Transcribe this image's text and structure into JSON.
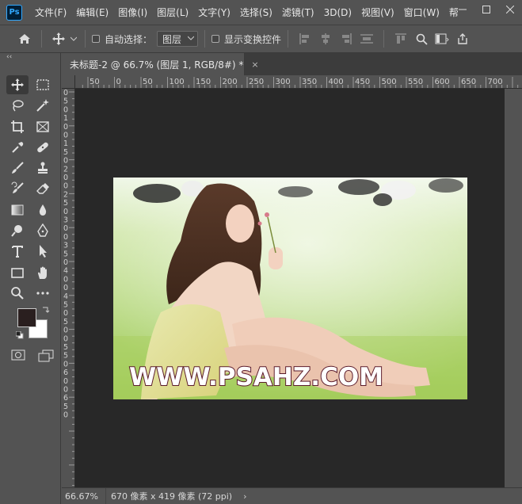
{
  "app": {
    "logo_text": "Ps",
    "menu": [
      "文件(F)",
      "编辑(E)",
      "图像(I)",
      "图层(L)",
      "文字(Y)",
      "选择(S)",
      "滤镜(T)",
      "3D(D)",
      "视图(V)",
      "窗口(W)",
      "帮"
    ],
    "window_controls": [
      "minimize-icon",
      "maximize-icon",
      "close-icon"
    ]
  },
  "options": {
    "home_icon": "home-icon",
    "move_icon": "move-tool-icon",
    "auto_select_label": "自动选择：",
    "auto_select_checked": false,
    "target_select": "图层",
    "show_transform_label": "显示变换控件",
    "show_transform_checked": false,
    "right_icons": [
      "align-top-edges-icon",
      "search-icon",
      "workspace-icon",
      "share-icon"
    ]
  },
  "tools": {
    "collapse_label": "‹‹",
    "items": [
      "move-tool-icon",
      "rect-marquee-icon",
      "lasso-icon",
      "magic-wand-icon",
      "crop-icon",
      "frame-icon",
      "eyedropper-icon",
      "healing-brush-icon",
      "brush-icon",
      "stamp-icon",
      "history-brush-icon",
      "eraser-icon",
      "gradient-icon",
      "blur-icon",
      "dodge-icon",
      "pen-icon",
      "type-icon",
      "path-select-icon",
      "rectangle-icon",
      "hand-icon",
      "zoom-icon",
      "more-tools-icon"
    ],
    "foreground_color": "#2a1f1f",
    "background_color": "#ffffff"
  },
  "document": {
    "tab_title": "未标题-2 @ 66.7% (图层 1, RGB/8#) *",
    "close_glyph": "×",
    "watermark": "WWW.PSAHZ.COM"
  },
  "rulers": {
    "horizontal": [
      "50",
      "0",
      "50",
      "100",
      "150",
      "200",
      "250",
      "300",
      "350",
      "400",
      "450",
      "500",
      "550",
      "600",
      "650",
      "700"
    ],
    "vertical": [
      "0",
      "5",
      "0",
      "1",
      "0",
      "0",
      "1",
      "5",
      "0",
      "2",
      "0",
      "0",
      "2",
      "5",
      "0",
      "3",
      "0",
      "0",
      "3",
      "5",
      "0",
      "4",
      "0",
      "0",
      "4",
      "5",
      "0",
      "5",
      "0",
      "0",
      "5",
      "5",
      "0",
      "6",
      "0",
      "0",
      "6",
      "5",
      "0"
    ]
  },
  "status": {
    "zoom": "66.67%",
    "doc_info": "670 像素 x 419 像素 (72 ppi)",
    "arrow": "›"
  }
}
